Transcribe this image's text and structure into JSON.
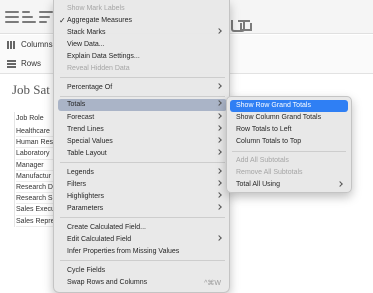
{
  "shelves": {
    "columns_label": "Columns",
    "rows_label": "Rows"
  },
  "sheet": {
    "title": "Job Sat",
    "column_header": "Job Role",
    "rows": [
      "Healthcare",
      "Human Res",
      "Laboratory",
      "Manager",
      "Manufactur",
      "Research D",
      "Research S",
      "Sales Execu",
      "Sales Repre"
    ]
  },
  "menu": {
    "show_mark_labels": "Show Mark Labels",
    "aggregate_measures": "Aggregate Measures",
    "stack_marks": "Stack Marks",
    "view_data": "View Data...",
    "explain_data_settings": "Explain Data Settings...",
    "reveal_hidden_data": "Reveal Hidden Data",
    "percentage_of": "Percentage Of",
    "totals": "Totals",
    "forecast": "Forecast",
    "trend_lines": "Trend Lines",
    "special_values": "Special Values",
    "table_layout": "Table Layout",
    "legends": "Legends",
    "filters": "Filters",
    "highlighters": "Highlighters",
    "parameters": "Parameters",
    "create_calculated_field": "Create Calculated Field...",
    "edit_calculated_field": "Edit Calculated Field",
    "infer_properties": "Infer Properties from Missing Values",
    "cycle_fields": "Cycle Fields",
    "swap_rows_columns": "Swap Rows and Columns",
    "swap_shortcut": "^⌘W"
  },
  "totals_submenu": {
    "show_row_grand_totals": "Show Row Grand Totals",
    "show_column_grand_totals": "Show Column Grand Totals",
    "row_totals_to_left": "Row Totals to Left",
    "column_totals_to_top": "Column Totals to Top",
    "add_all_subtotals": "Add All Subtotals",
    "remove_all_subtotals": "Remove All Subtotals",
    "total_all_using": "Total All Using"
  },
  "colors": {
    "selection": "#2f7ff4",
    "menu_hover": "#aab4c7",
    "menu_bg": "#e8e8e8"
  }
}
